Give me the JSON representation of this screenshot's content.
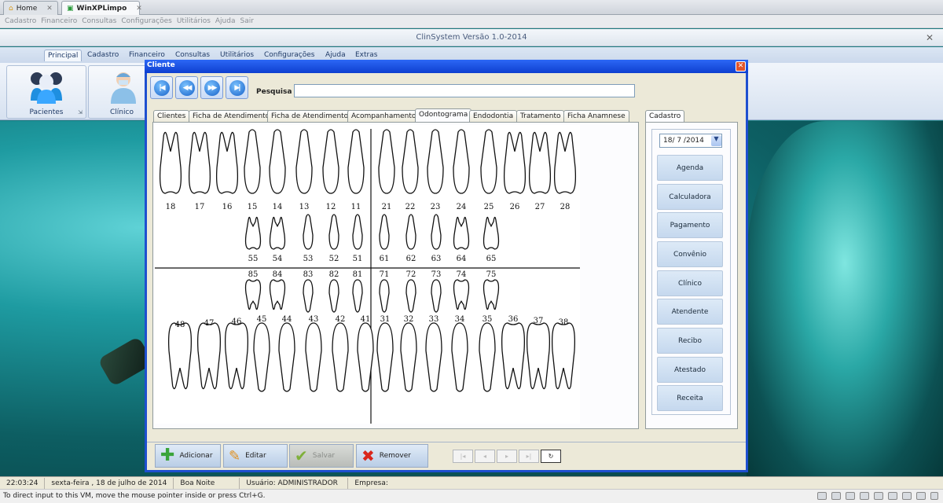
{
  "host_tabs": [
    {
      "label": "Home"
    },
    {
      "label": "WinXPLimpo"
    }
  ],
  "host_menu": [
    "Cadastro",
    "Financeiro",
    "Consultas",
    "Configurações",
    "Utilitários",
    "Ajuda",
    "Sair"
  ],
  "app_title": "ClinSystem Versão 1.0-2014",
  "ribbon_tabs": [
    "Principal",
    "Cadastro",
    "Financeiro",
    "Consultas",
    "Utilitários",
    "Configurações",
    "Ajuda",
    "Extras"
  ],
  "ribbon_groups": [
    {
      "label": "Pacientes"
    },
    {
      "label": "Clínico"
    }
  ],
  "dialog": {
    "title": "Cliente",
    "search_label": "Pesquisa",
    "search_value": "",
    "tabs": [
      "Clientes",
      "Ficha de Atendimento",
      "Ficha de Atendimento",
      "Acompanhamento",
      "Odontograma",
      "Endodontia",
      "Tratamento",
      "Ficha Anamnese"
    ],
    "active_tab": "Odontograma",
    "side_tab": "Cadastro",
    "date": "18/ 7 /2014",
    "side_buttons": [
      "Agenda",
      "Calculadora",
      "Pagamento",
      "Convênio",
      "Clínico",
      "Atendente",
      "Recibo",
      "Atestado",
      "Receita"
    ],
    "bottom_buttons": {
      "add": "Adicionar",
      "edit": "Editar",
      "save": "Salvar",
      "remove": "Remover"
    },
    "odontogram": {
      "upper_permanent_right": [
        "18",
        "17",
        "16",
        "15",
        "14",
        "13",
        "12",
        "11"
      ],
      "upper_permanent_left": [
        "21",
        "22",
        "23",
        "24",
        "25",
        "26",
        "27",
        "28"
      ],
      "upper_deciduous_right": [
        "55",
        "54",
        "53",
        "52",
        "51"
      ],
      "upper_deciduous_left": [
        "61",
        "62",
        "63",
        "64",
        "65"
      ],
      "lower_deciduous_right": [
        "85",
        "84",
        "83",
        "82",
        "81"
      ],
      "lower_deciduous_left": [
        "71",
        "72",
        "73",
        "74",
        "75"
      ],
      "lower_permanent_right": [
        "48",
        "47",
        "46",
        "45",
        "44",
        "43",
        "42",
        "41"
      ],
      "lower_permanent_left": [
        "31",
        "32",
        "33",
        "34",
        "35",
        "36",
        "37",
        "38"
      ]
    }
  },
  "status": {
    "time": "22:03:24",
    "date": "sexta-feira , 18 de julho de 2014",
    "greeting": "Boa Noite",
    "user": "Usuário: ADMINISTRADOR",
    "company": "Empresa:"
  },
  "vm_hint": "To direct input to this VM, move the mouse pointer inside or press Ctrl+G."
}
